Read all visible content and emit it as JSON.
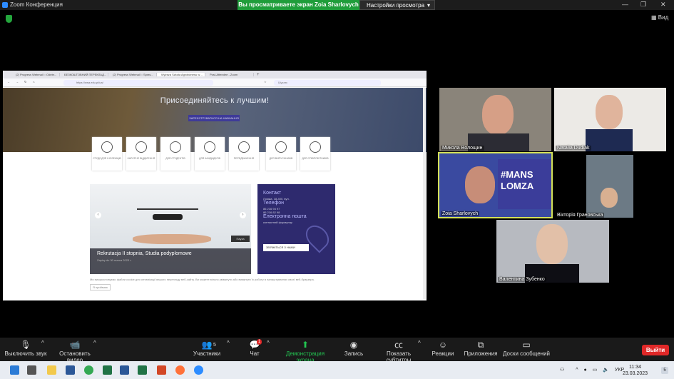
{
  "window": {
    "title": "Zoom Конференция"
  },
  "share_banner": "Вы просматриваете экран Zoia Sharlovych",
  "view_options": "Настройки просмотра",
  "view_button": "Вид",
  "browser": {
    "tabs": [
      "(2) Progress Webmail :: Odebr...",
      "БЕЗКОШТОВНИЙ ПЕРЕКЛАД...",
      "(2) Progress Webmail :: Sprav...",
      "Wyższa Szkoła Agrobiznesu w ...",
      "Post-Attendee - Zoom"
    ],
    "url": "https://wsa.edu.pl/ua/",
    "search_placeholder": "Шукаю"
  },
  "site": {
    "hero_title": "Присоединяйтесь к лучшим!",
    "hero_button": "ЗАРЕЄСТРУВАТИСЯ НА НАВЧАННЯ",
    "categories": [
      "СТУДІЇ ДЛЯ ІНОЗЕМЦІВ",
      "КАРЄРНЕ ВІДДІЛЕННЯ",
      "ДЛЯ СТУДЕНТІВ",
      "ДЛЯ КАНДИДАТІВ",
      "ПЕРЕДБАЧЕННЯ",
      "ДЛЯ ВИПУСКНИКІВ",
      "ДЛЯ СПІВРОБІТНИКІВ"
    ],
    "slide_title": "Rekrutacja II stopnia, Studia podyplomowe",
    "slide_date": "Zapisy do 30 marca 2023 r.",
    "slide_pause": "Пауза",
    "contact": {
      "heading": "Контакт",
      "address": "Ломжа, 18-400, вул.",
      "phone_heading": "Телефон",
      "phone1": "86 216 94 97",
      "phone2": "86 216 82 98",
      "email_heading": "Електронна пошта",
      "email_note": "контактний формуляр",
      "button": "ЗВ'ЯЖІТЬСЯ З НАМИ"
    },
    "cookie_text": "Ми використовуємо файли cookie для оптимізації вашого перегляду веб-сайту. Ви можете вільно увімкнути або вимкнути їх роботу в налаштуваннях своєї веб-браузера.",
    "cookie_button": "Я приймаю"
  },
  "participants": [
    {
      "name": "Микола Волощин"
    },
    {
      "name": "Natalia Dudiak"
    },
    {
      "name": "Zoia Sharlovych"
    },
    {
      "name": "Вікторія Грановська"
    },
    {
      "name": "Валентина Зубенко"
    }
  ],
  "toolbar": {
    "mute": "Выключить звук",
    "video": "Остановить видео",
    "participants": "Участники",
    "participants_count": "5",
    "chat": "Чат",
    "chat_badge": "1",
    "share": "Демонстрация экрана",
    "record": "Запись",
    "captions": "Показать субтитры",
    "reactions": "Реакции",
    "apps": "Приложения",
    "whiteboards": "Доски сообщений",
    "leave": "Выйти"
  },
  "taskbar": {
    "lang": "УКР",
    "time": "11:34",
    "date": "23.03.2023",
    "notifications": "5"
  },
  "colors": {
    "share_green": "#1f9d3a",
    "leave_red": "#e02828",
    "speaker_highlight": "#d4e157",
    "site_purple": "#2e2a6e"
  }
}
